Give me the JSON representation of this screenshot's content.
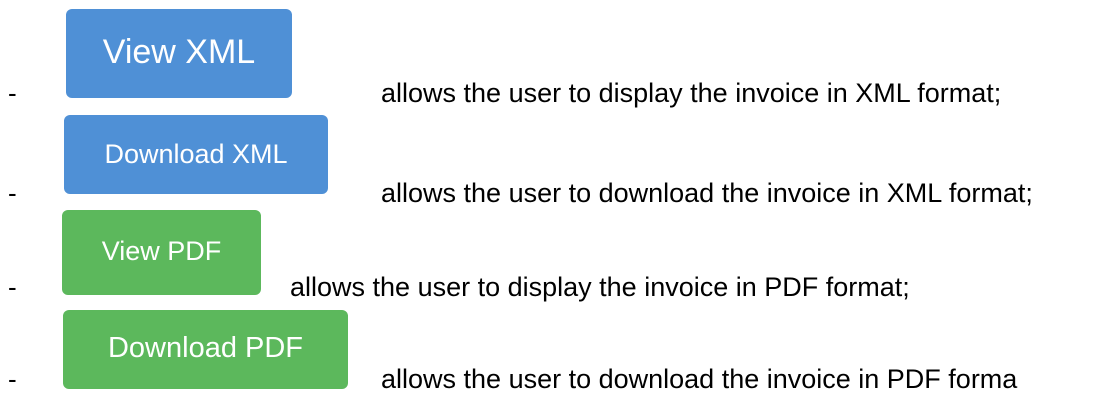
{
  "items": [
    {
      "bullet": "-",
      "button_label": "View XML",
      "button_color": "#4f90d6",
      "description": "allows the user to display the invoice in XML format;"
    },
    {
      "bullet": "-",
      "button_label": "Download XML",
      "button_color": "#4f90d6",
      "description": "allows the user to download the invoice in XML format;"
    },
    {
      "bullet": "-",
      "button_label": "View PDF",
      "button_color": "#5cb85c",
      "description": "allows the user to display the invoice in PDF format;"
    },
    {
      "bullet": "-",
      "button_label": "Download PDF",
      "button_color": "#5cb85c",
      "description": "allows the user to download the invoice in PDF forma"
    }
  ]
}
